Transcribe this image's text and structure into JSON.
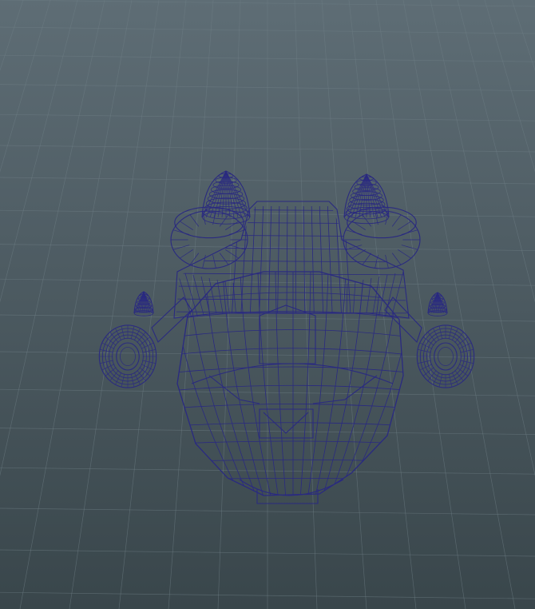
{
  "viewport": {
    "background_top": "#5e6d75",
    "background_bottom": "#39464b",
    "grid_color": "#6f7f86",
    "grid_visible": true,
    "view": "perspective"
  },
  "model": {
    "display_mode": "wireframe",
    "wire_color": "#2a2a80",
    "selected": false
  }
}
